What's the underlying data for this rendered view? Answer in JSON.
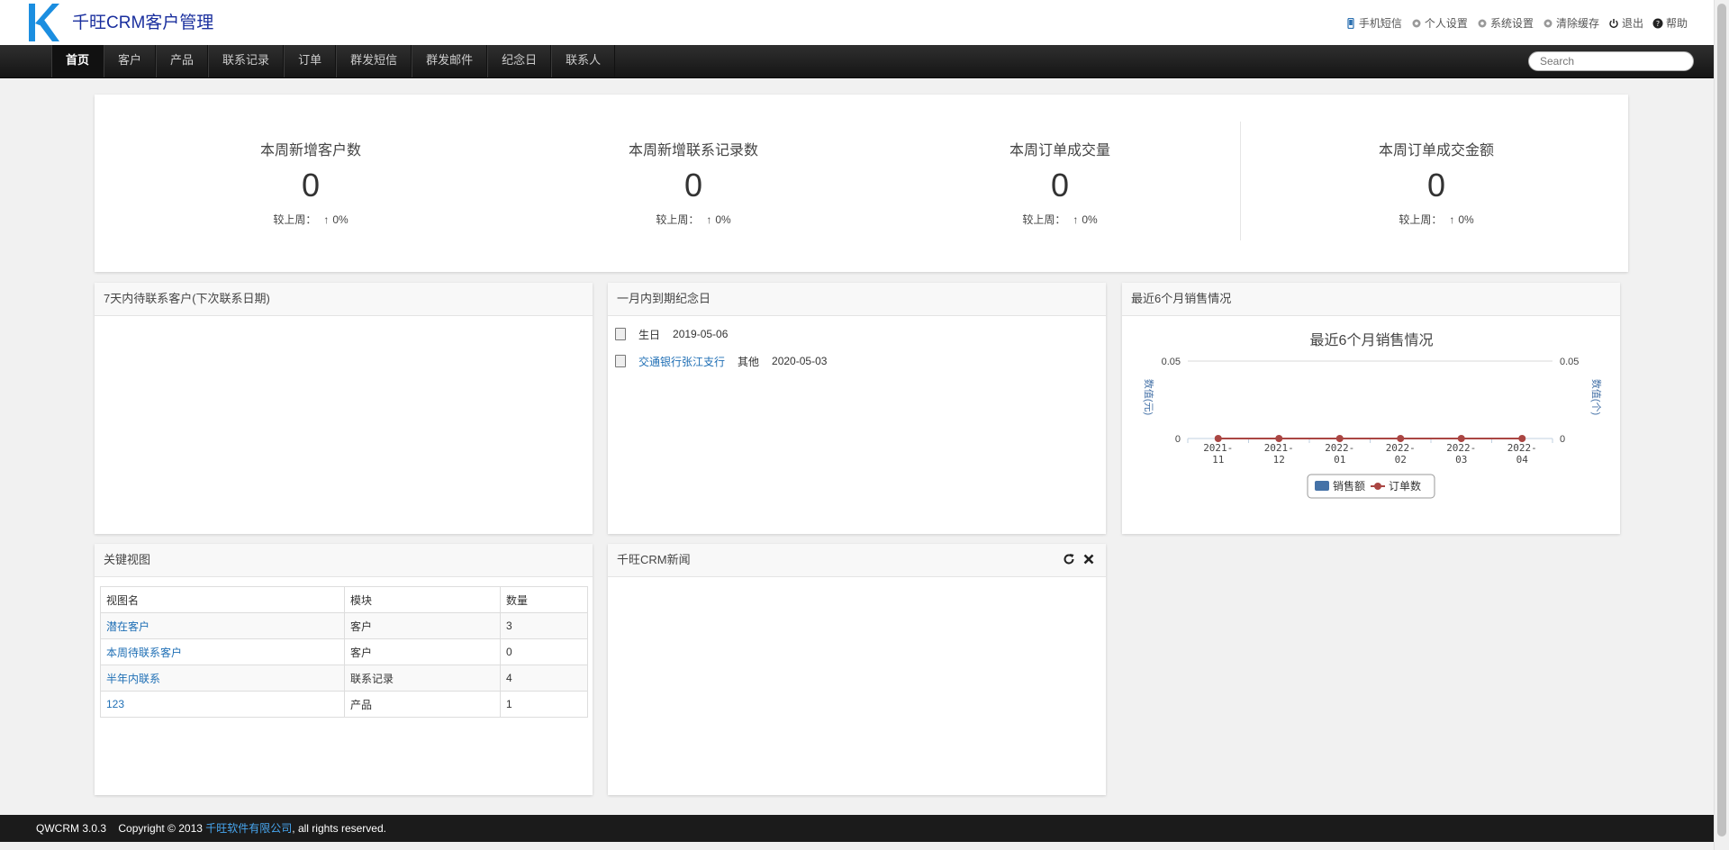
{
  "app": {
    "title": "千旺CRM客户管理"
  },
  "top_links": [
    {
      "label": "手机短信",
      "icon": "phone-icon"
    },
    {
      "label": "个人设置",
      "icon": "gear-icon"
    },
    {
      "label": "系统设置",
      "icon": "gear-icon"
    },
    {
      "label": "清除缓存",
      "icon": "gear-icon"
    },
    {
      "label": "退出",
      "icon": "power-icon"
    },
    {
      "label": "帮助",
      "icon": "help-icon"
    }
  ],
  "nav": {
    "items": [
      "首页",
      "客户",
      "产品",
      "联系记录",
      "订单",
      "群发短信",
      "群发邮件",
      "纪念日",
      "联系人"
    ],
    "active": 0,
    "search_placeholder": "Search"
  },
  "stats": [
    {
      "label": "本周新增客户数",
      "value": "0",
      "cmp_label": "较上周：",
      "cmp_value": "0%"
    },
    {
      "label": "本周新增联系记录数",
      "value": "0",
      "cmp_label": "较上周：",
      "cmp_value": "0%"
    },
    {
      "label": "本周订单成交量",
      "value": "0",
      "cmp_label": "较上周：",
      "cmp_value": "0%"
    },
    {
      "label": "本周订单成交金额",
      "value": "0",
      "cmp_label": "较上周：",
      "cmp_value": "0%"
    }
  ],
  "panels": {
    "contacts_7d": {
      "title": "7天内待联系客户(下次联系日期)"
    },
    "anniversaries": {
      "title": "一月内到期纪念日",
      "rows": [
        {
          "name": "",
          "type": "生日",
          "date": "2019-05-06"
        },
        {
          "name": "交通银行张江支行",
          "type": "其他",
          "date": "2020-05-03"
        }
      ]
    },
    "sales6m": {
      "title": "最近6个月销售情况"
    },
    "key_views": {
      "title": "关键视图",
      "columns": [
        "视图名",
        "模块",
        "数量"
      ],
      "rows": [
        {
          "name": "潜在客户",
          "module": "客户",
          "count": "3"
        },
        {
          "name": "本周待联系客户",
          "module": "客户",
          "count": "0"
        },
        {
          "name": "半年内联系",
          "module": "联系记录",
          "count": "4"
        },
        {
          "name": "123",
          "module": "产品",
          "count": "1"
        }
      ]
    },
    "news": {
      "title": "千旺CRM新闻"
    }
  },
  "chart_data": {
    "type": "line",
    "title": "最近6个月销售情况",
    "categories": [
      "2021-11",
      "2021-12",
      "2022-01",
      "2022-02",
      "2022-03",
      "2022-04"
    ],
    "category_labels": [
      [
        "2021-",
        "11"
      ],
      [
        "2021-",
        "12"
      ],
      [
        "2022-",
        "01"
      ],
      [
        "2022-",
        "02"
      ],
      [
        "2022-",
        "03"
      ],
      [
        "2022-",
        "04"
      ]
    ],
    "series": [
      {
        "name": "销售额",
        "type": "bar",
        "color": "#4572a7",
        "values": [
          0,
          0,
          0,
          0,
          0,
          0
        ]
      },
      {
        "name": "订单数",
        "type": "line",
        "color": "#aa4643",
        "values": [
          0,
          0,
          0,
          0,
          0,
          0
        ]
      }
    ],
    "y_left": {
      "label": "数值(元)",
      "ylim": [
        0,
        0.05
      ],
      "ticks": [
        "0.05",
        "0"
      ]
    },
    "y_right": {
      "label": "数值(个)",
      "ylim": [
        0,
        0.05
      ],
      "ticks": [
        "0.05",
        "0"
      ]
    },
    "legend": "bottom-center"
  },
  "footer": {
    "version": "QWCRM 3.0.3",
    "copyright": "Copyright © 2013",
    "company": "千旺软件有限公司",
    "rights": ", all rights reserved."
  }
}
